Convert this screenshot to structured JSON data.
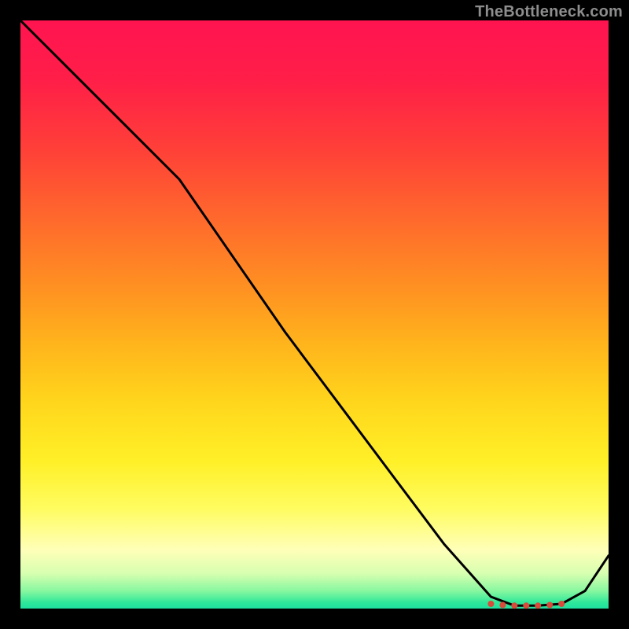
{
  "watermark": "TheBottleneck.com",
  "chart_data": {
    "type": "line",
    "title": "",
    "xlabel": "",
    "ylabel": "",
    "xlim": [
      0,
      100
    ],
    "ylim": [
      0,
      100
    ],
    "series": [
      {
        "name": "curve",
        "x": [
          0,
          9,
          18,
          27,
          36,
          45,
          54,
          63,
          72,
          80,
          84,
          88,
          92,
          96,
          100
        ],
        "values": [
          100,
          91,
          82,
          73,
          60,
          47,
          35,
          23,
          11,
          2,
          0.5,
          0.5,
          0.8,
          3,
          9
        ]
      }
    ],
    "markers": {
      "x": [
        80,
        82,
        84,
        86,
        88,
        90,
        92
      ],
      "y": [
        0.8,
        0.6,
        0.5,
        0.5,
        0.5,
        0.6,
        0.8
      ],
      "color": "#d84a3a"
    },
    "gradient_stops": [
      {
        "pos": 0,
        "color": "#ff1450"
      },
      {
        "pos": 22,
        "color": "#ff4038"
      },
      {
        "pos": 45,
        "color": "#ff8f22"
      },
      {
        "pos": 65,
        "color": "#ffd61c"
      },
      {
        "pos": 83,
        "color": "#fffc60"
      },
      {
        "pos": 94,
        "color": "#d8ffb0"
      },
      {
        "pos": 100,
        "color": "#1ee0a0"
      }
    ]
  }
}
